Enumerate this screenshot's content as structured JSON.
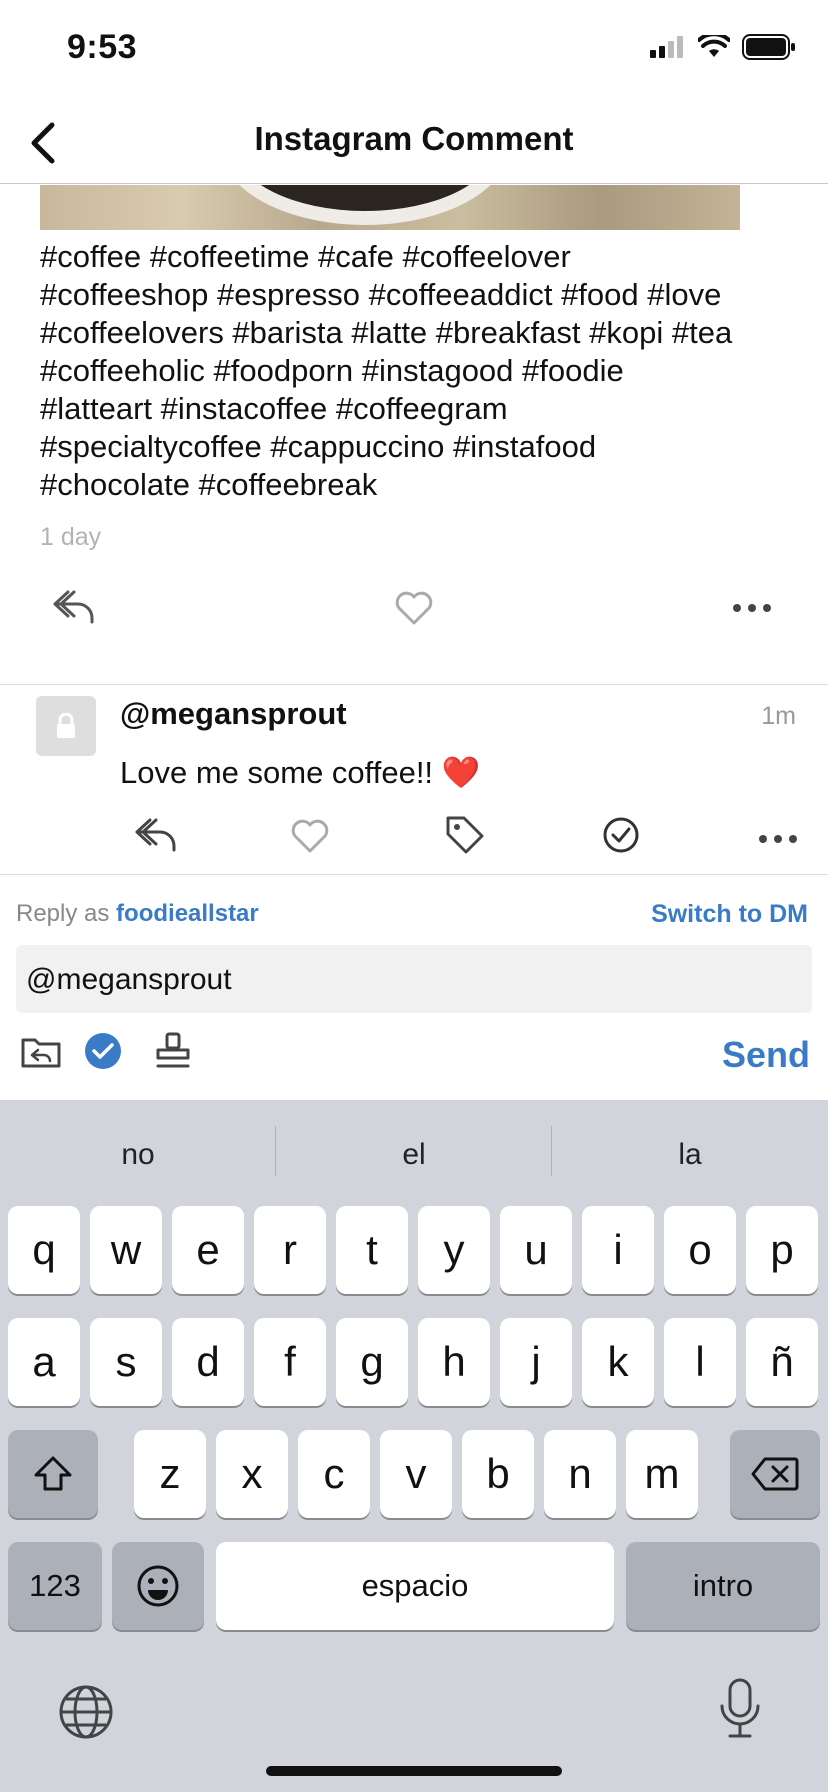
{
  "status": {
    "time": "9:53"
  },
  "nav": {
    "title": "Instagram Comment"
  },
  "post": {
    "caption_lines": [
      "#coffee #coffeetime #cafe #coffeelover",
      "#coffeeshop #espresso #coffeeaddict #food #love",
      "#coffeelovers #barista #latte #breakfast #kopi #tea",
      "#coffeeholic #foodporn #instagood #foodie",
      "#latteart #instacoffee #coffeegram",
      "#specialtycoffee #cappuccino #instafood",
      "#chocolate #coffeebreak"
    ],
    "time": "1 day"
  },
  "comment": {
    "user": "@megansprout",
    "time": "1m",
    "text": "Love me some coffee!! ❤️"
  },
  "reply": {
    "prefix": "Reply as",
    "handle": "foodieallstar",
    "switch_label": "Switch to DM",
    "input_value": "@megansprout",
    "send_label": "Send"
  },
  "keyboard": {
    "suggestions": [
      "no",
      "el",
      "la"
    ],
    "row1": [
      "q",
      "w",
      "e",
      "r",
      "t",
      "y",
      "u",
      "i",
      "o",
      "p"
    ],
    "row2": [
      "a",
      "s",
      "d",
      "f",
      "g",
      "h",
      "j",
      "k",
      "l",
      "ñ"
    ],
    "row3": [
      "z",
      "x",
      "c",
      "v",
      "b",
      "n",
      "m"
    ],
    "numbers_label": "123",
    "space_label": "espacio",
    "return_label": "intro"
  },
  "colors": {
    "accent": "#3a7bc8",
    "keyboard_bg": "#d1d4da"
  }
}
